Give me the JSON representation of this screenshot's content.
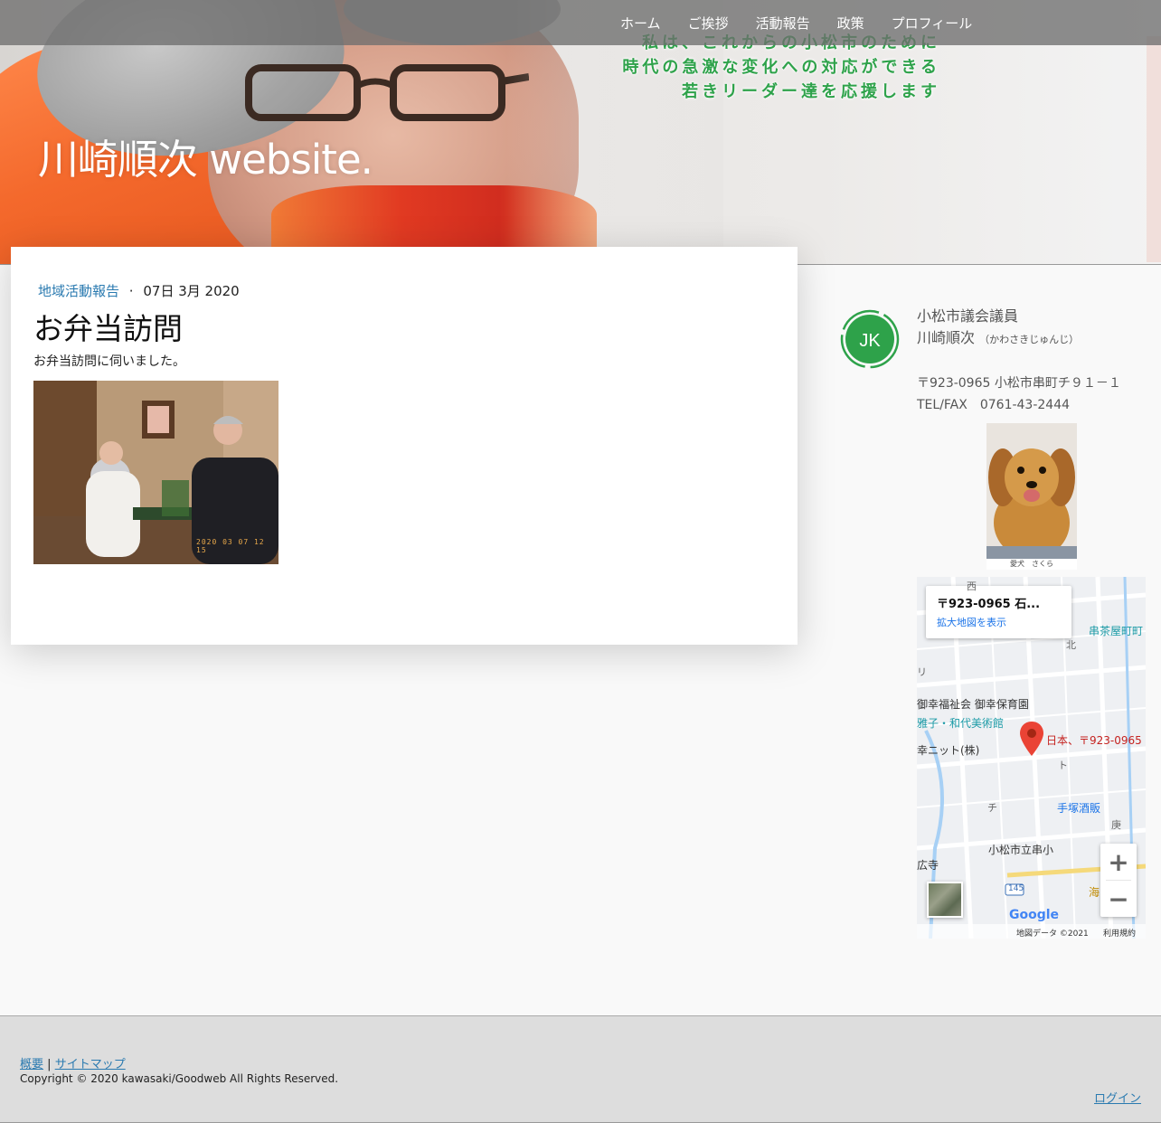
{
  "nav": {
    "items": [
      "ホーム",
      "ご挨拶",
      "活動報告",
      "政策",
      "プロフィール"
    ]
  },
  "hero": {
    "slogan": [
      "私は、これからの小松市のために",
      "時代の急激な変化への対応ができる",
      "若きリーダー達を応援します"
    ],
    "site_title": "川崎順次 website."
  },
  "post": {
    "category": "地域活動報告",
    "separator": "·",
    "date": "07日 3月 2020",
    "title": "お弁当訪問",
    "body": "お弁当訪問に伺いました。",
    "photo_timestamp": "2020 03 07 12 15"
  },
  "sidebar": {
    "logo_text": "JK",
    "role": "小松市議会議員",
    "name": "川崎順次",
    "kana": "（かわさきじゅんじ）",
    "address": "〒923-0965 小松市串町チ９１－１",
    "tel": "TEL/FAX　0761-43-2444",
    "dog_caption": "愛犬　さくら"
  },
  "map": {
    "info_title": "〒923-0965 石...",
    "info_link": "拡大地図を表示",
    "labels": {
      "chaya": "串茶屋町町",
      "kita": "北",
      "fukushi": "御幸福祉会 御幸保育園",
      "museum": "雅子・和代美術館",
      "knit": "幸ニット(株)",
      "pin": "日本、〒923-0965",
      "to": "ト",
      "chi": "チ",
      "sake": "手塚酒販",
      "kou": "庚",
      "school": "小松市立串小",
      "temple": "広寺",
      "route": "145",
      "sea": "海",
      "nishi": "西",
      "ri": "リ"
    },
    "copyright": "地図データ ©2021",
    "terms": "利用規約",
    "google": "Google"
  },
  "footer": {
    "link1": "概要",
    "divider": "|",
    "link2": "サイトマップ",
    "copyright": "Copyright © 2020 kawasaki/Goodweb All Rights Reserved.",
    "login": "ログイン"
  },
  "colors": {
    "accent_green": "#2ea24a",
    "link_blue": "#2a7ab0",
    "nav_bg": "#6e6e6e"
  }
}
